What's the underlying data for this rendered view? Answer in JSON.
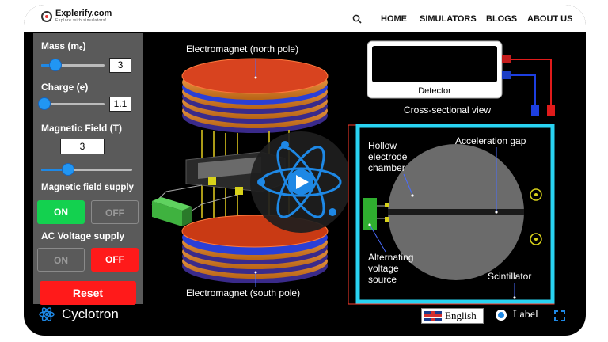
{
  "nav": {
    "brand": "Explerify.com",
    "tagline": "Explore with simulators!",
    "items": [
      "HOME",
      "SIMULATORS",
      "BLOGS",
      "ABOUT US"
    ]
  },
  "controls": {
    "mass": {
      "label": "Mass (mₑ)",
      "value": "3",
      "slider_fraction": 0.22
    },
    "charge": {
      "label": "Charge (e)",
      "value": "1.1",
      "slider_fraction": 0.02
    },
    "magnetic_field": {
      "label": "Magnetic Field (T)",
      "value": "3",
      "slider_fraction": 0.3
    },
    "magnetic_supply": {
      "label": "Magnetic field supply",
      "on": "ON",
      "off": "OFF",
      "state": "ON"
    },
    "ac_supply": {
      "label": "AC Voltage supply",
      "on": "ON",
      "off": "OFF",
      "state": "OFF"
    },
    "reset_label": "Reset"
  },
  "scene": {
    "north_label": "Electromagnet (north pole)",
    "south_label": "Electromagnet (south pole)",
    "detector_label": "Detector",
    "cross_section_title": "Cross-sectional view",
    "hollow_label_1": "Hollow",
    "hollow_label_2": "electrode",
    "hollow_label_3": "chamber",
    "gap_label": "Acceleration gap",
    "source_label_1": "Alternating",
    "source_label_2": "voltage",
    "source_label_3": "source",
    "scintillator_label": "Scintillator"
  },
  "footer": {
    "title": "Cyclotron",
    "language": "English",
    "label_toggle": "Label"
  },
  "colors": {
    "accent_blue": "#1e88e5",
    "on_green": "#13d14f",
    "off_red": "#ff1a1a",
    "cross_section_border": "#29d3f2"
  }
}
